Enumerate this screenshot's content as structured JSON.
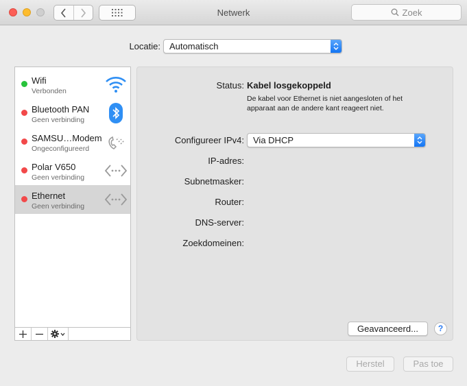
{
  "window": {
    "title": "Netwerk",
    "search_placeholder": "Zoek"
  },
  "location": {
    "label": "Locatie:",
    "value": "Automatisch"
  },
  "services": [
    {
      "name": "Wifi",
      "status": "Verbonden",
      "status_color": "#27c33b",
      "icon": "wifi-icon"
    },
    {
      "name": "Bluetooth PAN",
      "status": "Geen verbinding",
      "status_color": "#f2494a",
      "icon": "bluetooth-icon"
    },
    {
      "name": "SAMSU…Modem",
      "status": "Ongeconfigureerd",
      "status_color": "#f2494a",
      "icon": "phone-modem-icon"
    },
    {
      "name": "Polar V650",
      "status": "Geen verbinding",
      "status_color": "#f2494a",
      "icon": "ethernet-arrows-icon"
    },
    {
      "name": "Ethernet",
      "status": "Geen verbinding",
      "status_color": "#f2494a",
      "icon": "ethernet-arrows-icon",
      "selected": true
    }
  ],
  "details": {
    "status_label": "Status:",
    "status_value": "Kabel losgekoppeld",
    "status_description": "De kabel voor Ethernet is niet aangesloten of het apparaat aan de andere kant reageert niet.",
    "ipv4_label": "Configureer IPv4:",
    "ipv4_value": "Via DHCP",
    "ip_label": "IP-adres:",
    "subnet_label": "Subnetmasker:",
    "router_label": "Router:",
    "dns_label": "DNS-server:",
    "search_domains_label": "Zoekdomeinen:",
    "advanced_button": "Geavanceerd...",
    "help_button": "?"
  },
  "footer": {
    "reset_button": "Herstel",
    "apply_button": "Pas toe"
  },
  "colors": {
    "accent": "#1375f4",
    "connected": "#27c33b",
    "disconnected": "#f2494a"
  }
}
